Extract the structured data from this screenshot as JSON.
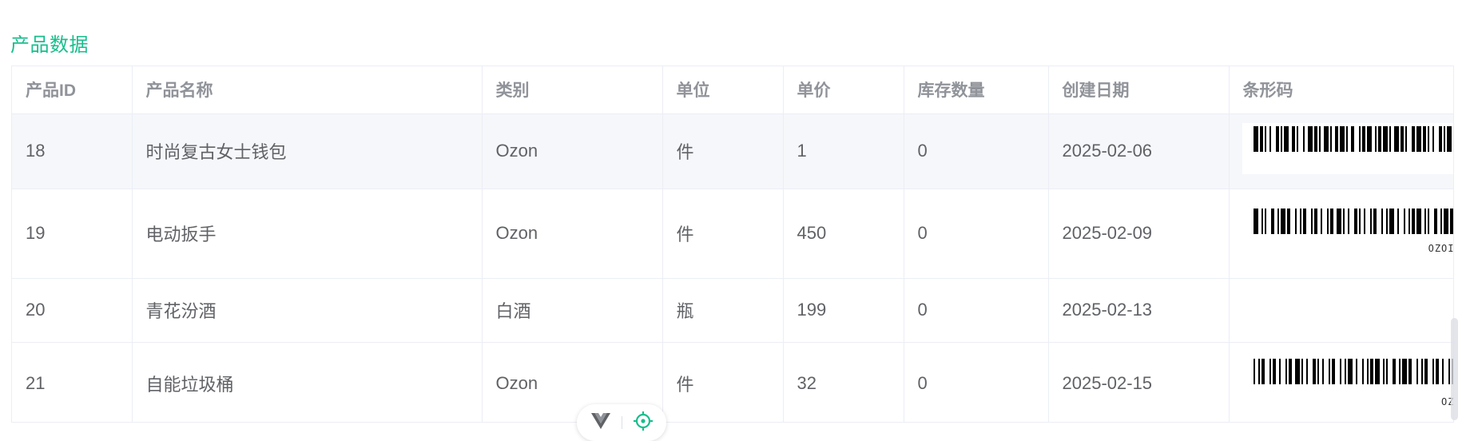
{
  "section": {
    "title": "产品数据"
  },
  "table": {
    "headers": [
      "产品ID",
      "产品名称",
      "类别",
      "单位",
      "单价",
      "库存数量",
      "创建日期",
      "条形码"
    ],
    "rows": [
      {
        "id": "18",
        "name": "时尚复古女士钱包",
        "category": "Ozon",
        "unit": "件",
        "price": "1",
        "stock": "0",
        "date": "2025-02-06",
        "barcode": {
          "show": true,
          "label": ""
        }
      },
      {
        "id": "19",
        "name": "电动扳手",
        "category": "Ozon",
        "unit": "件",
        "price": "450",
        "stock": "0",
        "date": "2025-02-09",
        "barcode": {
          "show": true,
          "label": "OZOI"
        }
      },
      {
        "id": "20",
        "name": "青花汾酒",
        "category": "白酒",
        "unit": "瓶",
        "price": "199",
        "stock": "0",
        "date": "2025-02-13",
        "barcode": {
          "show": false,
          "label": ""
        }
      },
      {
        "id": "21",
        "name": "自能垃圾桶",
        "category": "Ozon",
        "unit": "件",
        "price": "32",
        "stock": "0",
        "date": "2025-02-15",
        "barcode": {
          "show": true,
          "label": "OZ"
        }
      }
    ]
  },
  "devtools": {
    "logo_icon": "vue-logo-icon",
    "inspect_icon": "crosshair-icon"
  },
  "colors": {
    "accent": "#19be8c",
    "header_text": "#909399",
    "body_text": "#606266",
    "border": "#ebeef5",
    "highlight_row": "#f5f7fa"
  }
}
